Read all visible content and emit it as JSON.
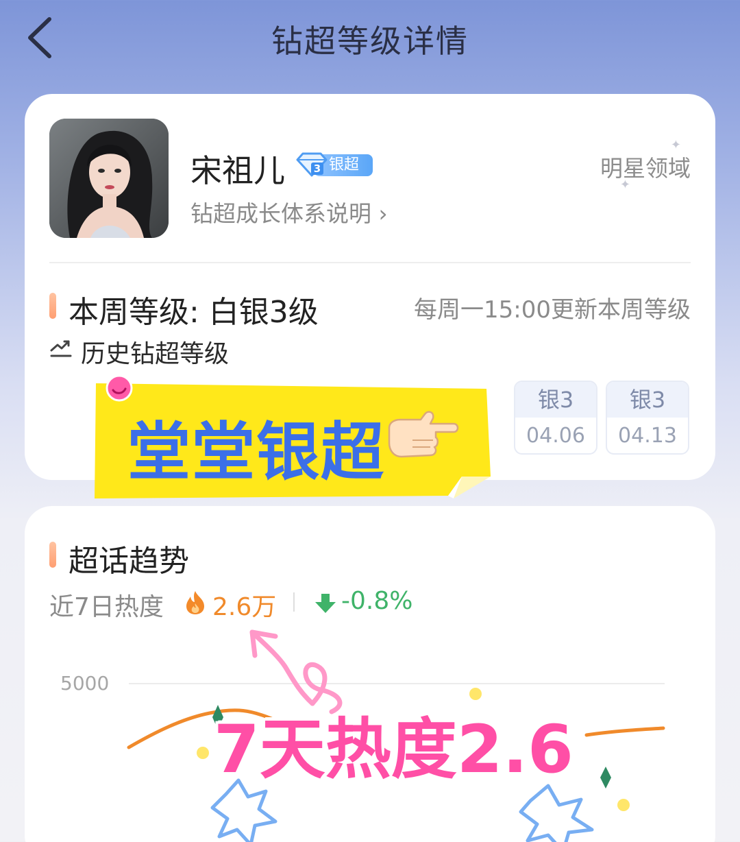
{
  "nav": {
    "title": "钻超等级详情",
    "back_icon": "chevron-left-icon"
  },
  "profile": {
    "name": "宋祖儿",
    "badge_label": "银超",
    "badge_level": "3",
    "growth_link": "钻超成长体系说明 ›",
    "domain": "明星领域"
  },
  "level": {
    "title": "本周等级: 白银3级",
    "update_note": "每周一15:00更新本周等级",
    "history_label": "历史钻超等级",
    "history": [
      {
        "level": "银3",
        "date": "04.06"
      },
      {
        "level": "银3",
        "date": "04.13"
      }
    ]
  },
  "sticker1": {
    "text": "堂堂银超"
  },
  "trend": {
    "title": "超话趋势",
    "heat_label": "近7日热度",
    "heat_value": "2.6万",
    "change_value": "-0.8%",
    "y_tick": "5000"
  },
  "sticker2": {
    "text": "7天热度2.6"
  },
  "colors": {
    "accent_orange": "#f08a2b",
    "down_green": "#3fb369",
    "sticker_yellow": "#ffe81a",
    "sticker_blue": "#3b6fe8",
    "sticker_pink": "#ff4fa6"
  }
}
